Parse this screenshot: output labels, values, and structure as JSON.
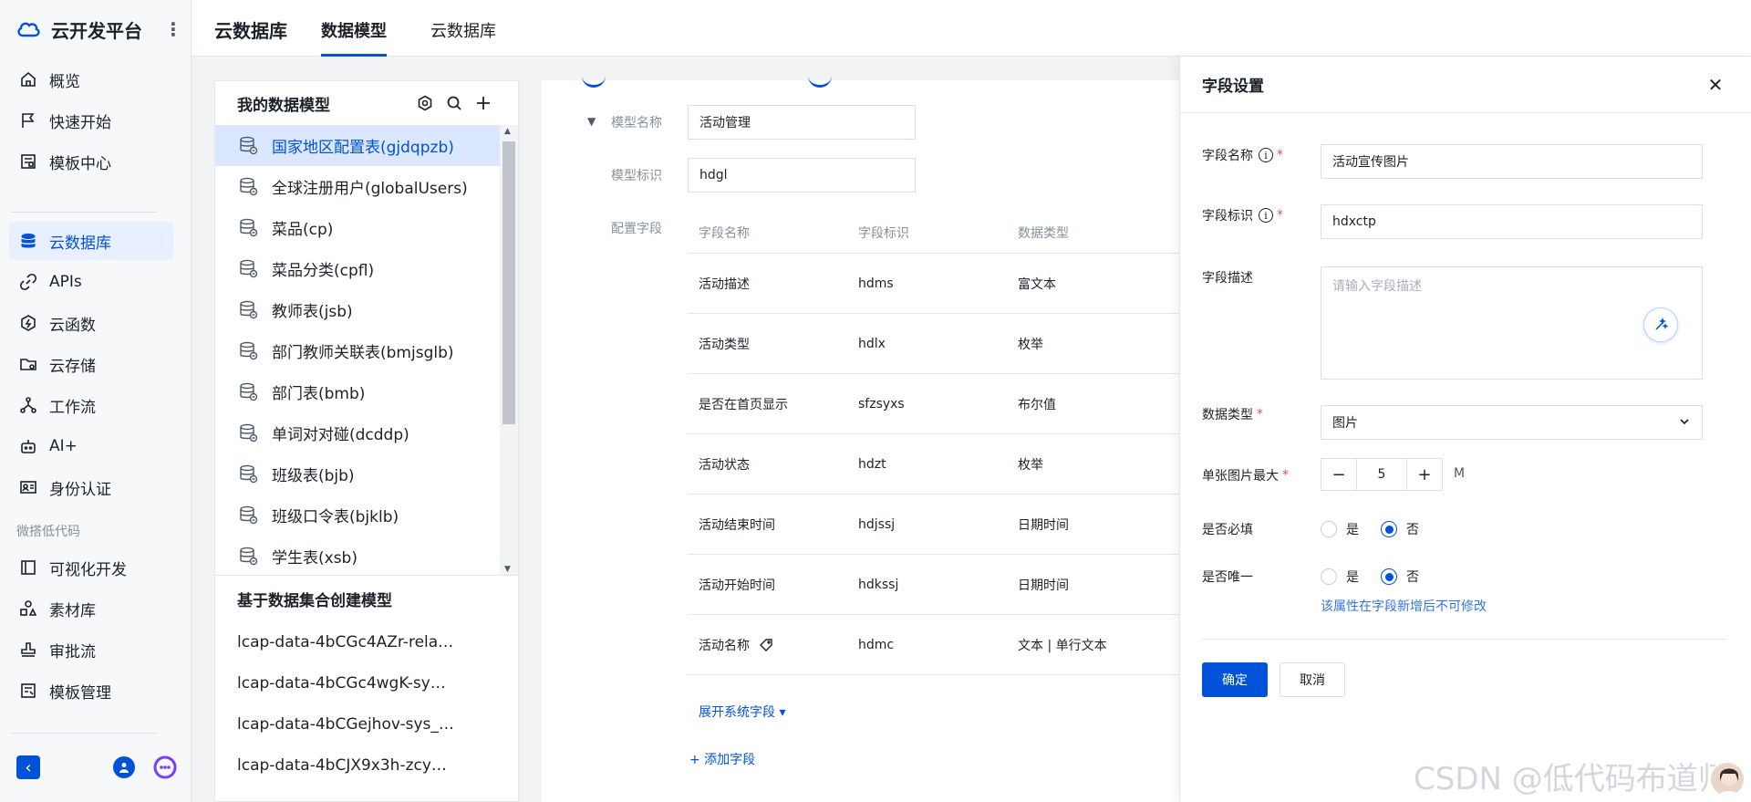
{
  "brand": {
    "title": "云开发平台"
  },
  "sidebar": {
    "items": [
      {
        "label": "概览",
        "icon": "home-icon"
      },
      {
        "label": "快速开始",
        "icon": "flag-icon"
      },
      {
        "label": "模板中心",
        "icon": "template-icon"
      }
    ],
    "items2": [
      {
        "label": "云数据库",
        "icon": "database-icon",
        "active": true
      },
      {
        "label": "APIs",
        "icon": "link-icon"
      },
      {
        "label": "云函数",
        "icon": "function-icon"
      },
      {
        "label": "云存储",
        "icon": "folder-icon"
      },
      {
        "label": "工作流",
        "icon": "workflow-icon"
      },
      {
        "label": "AI+",
        "icon": "robot-icon"
      },
      {
        "label": "身份认证",
        "icon": "id-card-icon"
      }
    ],
    "section_title": "微搭低代码",
    "items3": [
      {
        "label": "可视化开发",
        "icon": "layout-icon"
      },
      {
        "label": "素材库",
        "icon": "shapes-icon"
      },
      {
        "label": "审批流",
        "icon": "stamp-icon"
      },
      {
        "label": "模板管理",
        "icon": "template-manage-icon"
      }
    ]
  },
  "topbar": {
    "title": "云数据库",
    "tabs": [
      "数据模型",
      "云数据库"
    ]
  },
  "models": {
    "title": "我的数据模型",
    "items": [
      "国家地区配置表(gjdqpzb)",
      "全球注册用户(globalUsers)",
      "菜品(cp)",
      "菜品分类(cpfl)",
      "教师表(jsb)",
      "部门教师关联表(bmjsglb)",
      "部门表(bmb)",
      "单词对对碰(dcddp)",
      "班级表(bjb)",
      "班级口令表(bjklb)",
      "学生表(xsb)"
    ],
    "section2_title": "基于数据集合创建模型",
    "datasets": [
      "lcap-data-4bCGc4AZr-rela…",
      "lcap-data-4bCGc4wgK-sy…",
      "lcap-data-4bCGejhov-sys_…",
      "lcap-data-4bCJX9x3h-zcy…"
    ]
  },
  "model_form": {
    "name_label": "模型名称",
    "name_value": "活动管理",
    "id_label": "模型标识",
    "id_value": "hdgl",
    "fields_label": "配置字段",
    "columns": [
      "字段名称",
      "字段标识",
      "数据类型"
    ],
    "rows": [
      [
        "活动描述",
        "hdms",
        "富文本"
      ],
      [
        "活动类型",
        "hdlx",
        "枚举"
      ],
      [
        "是否在首页显示",
        "sfzsyxs",
        "布尔值"
      ],
      [
        "活动状态",
        "hdzt",
        "枚举"
      ],
      [
        "活动结束时间",
        "hdjssj",
        "日期时间"
      ],
      [
        "活动开始时间",
        "hdkssj",
        "日期时间"
      ],
      [
        "活动名称",
        "hdmc",
        "文本 | 单行文本"
      ]
    ],
    "expand_system": "展开系统字段 ▾",
    "add_field": "+ 添加字段"
  },
  "drawer": {
    "title": "字段设置",
    "field_name_label": "字段名称",
    "field_name_value": "活动宣传图片",
    "field_id_label": "字段标识",
    "field_id_value": "hdxctp",
    "desc_label": "字段描述",
    "desc_placeholder": "请输入字段描述",
    "type_label": "数据类型",
    "type_value": "图片",
    "max_label": "单张图片最大",
    "max_value": "5",
    "max_unit": "M",
    "required_label": "是否必填",
    "unique_label": "是否唯一",
    "yes": "是",
    "no": "否",
    "required_value": "否",
    "unique_value": "否",
    "hint": "该属性在字段新增后不可修改",
    "ok": "确定",
    "cancel": "取消"
  },
  "watermark": "CSDN @低代码布道师",
  "colors": {
    "primary": "#0052d9",
    "required": "#e34d59"
  }
}
